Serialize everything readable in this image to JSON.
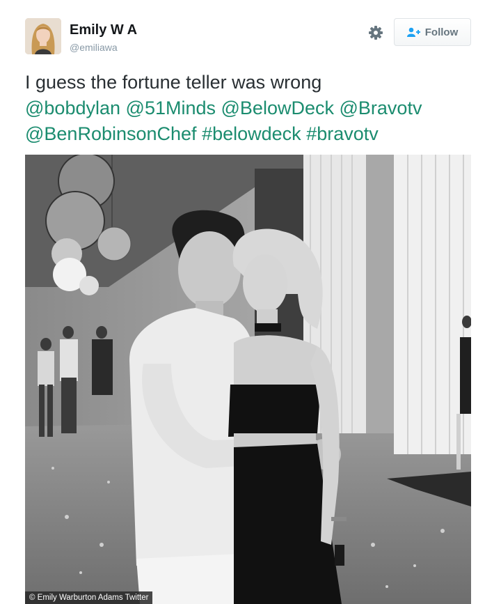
{
  "user": {
    "name": "Emily W A",
    "handle": "@emiliawa"
  },
  "actions": {
    "follow_label": "Follow",
    "gear_icon": "gear-icon",
    "follow_icon": "add-user-icon"
  },
  "tweet": {
    "text": "I guess the fortune teller was wrong",
    "mentions": [
      "@bobdylan",
      "@51Minds",
      "@BelowDeck",
      "@Bravotv",
      "@BenRobinsonChef"
    ],
    "hashtags": [
      "#belowdeck",
      "#bravotv"
    ]
  },
  "photo": {
    "credit": "© Emily Warburton Adams Twitter"
  },
  "colors": {
    "link": "#1b8c6f",
    "text": "#292f33",
    "muted": "#8899a6"
  }
}
